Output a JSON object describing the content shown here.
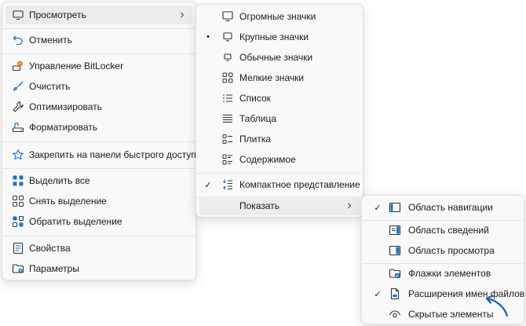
{
  "main_menu": {
    "items": [
      {
        "label": "Просмотреть",
        "icon": "monitor-icon",
        "has_submenu": true
      },
      {
        "label": "Отменить",
        "icon": "undo-icon"
      },
      {
        "label": "Управление BitLocker",
        "icon": "bitlocker-key-icon"
      },
      {
        "label": "Очистить",
        "icon": "broom-icon"
      },
      {
        "label": "Оптимизировать",
        "icon": "wrench-icon"
      },
      {
        "label": "Форматировать",
        "icon": "format-drive-icon"
      },
      {
        "label": "Закрепить на панели быстрого доступа",
        "icon": "star-icon"
      },
      {
        "label": "Выделить все",
        "icon": "select-all-icon"
      },
      {
        "label": "Снять выделение",
        "icon": "select-none-icon"
      },
      {
        "label": "Обратить выделение",
        "icon": "invert-selection-icon"
      },
      {
        "label": "Свойства",
        "icon": "properties-icon"
      },
      {
        "label": "Параметры",
        "icon": "options-folder-icon"
      }
    ]
  },
  "view_menu": {
    "items": [
      {
        "label": "Огромные значки",
        "icon": "extra-large-icons-icon"
      },
      {
        "label": "Крупные значки",
        "icon": "large-icons-icon",
        "marker": "•"
      },
      {
        "label": "Обычные значки",
        "icon": "medium-icons-icon"
      },
      {
        "label": "Мелкие значки",
        "icon": "small-icons-icon"
      },
      {
        "label": "Список",
        "icon": "list-icon"
      },
      {
        "label": "Таблица",
        "icon": "details-icon"
      },
      {
        "label": "Плитка",
        "icon": "tiles-icon"
      },
      {
        "label": "Содержимое",
        "icon": "content-icon"
      },
      {
        "label": "Компактное представление",
        "icon": "compact-view-icon",
        "marker": "✓"
      },
      {
        "label": "Показать",
        "has_submenu": true
      }
    ]
  },
  "show_menu": {
    "items": [
      {
        "label": "Область навигации",
        "icon": "navigation-pane-icon",
        "marker": "✓"
      },
      {
        "label": "Область сведений",
        "icon": "details-pane-icon"
      },
      {
        "label": "Область просмотра",
        "icon": "preview-pane-icon"
      },
      {
        "label": "Флажки элементов",
        "icon": "item-checkboxes-icon"
      },
      {
        "label": "Расширения имен файлов",
        "icon": "file-extension-icon",
        "marker": "✓"
      },
      {
        "label": "Скрытые элементы",
        "icon": "eye-icon"
      }
    ]
  },
  "colors": {
    "accent": "#1f6fc8",
    "annotation_arrow": "#1a5fb4",
    "hover_background": "#ececec",
    "menu_background": "#f9f9f9"
  }
}
